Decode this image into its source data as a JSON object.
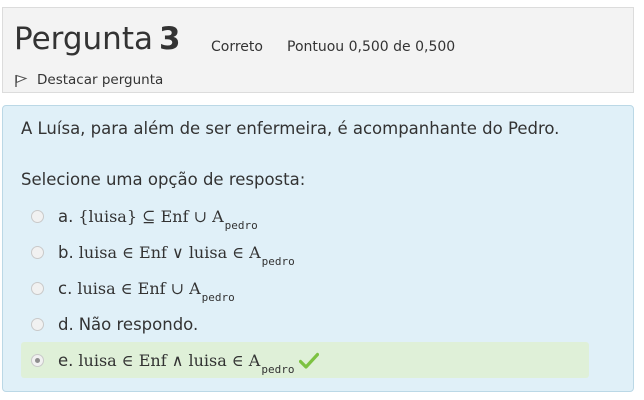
{
  "question": {
    "title_word": "Pergunta",
    "number": "3",
    "state": "Correto",
    "grade": "Pontuou 0,500 de 0,500",
    "flag_label": "Destacar pergunta"
  },
  "content": {
    "question_text": "A Luísa, para além de ser enfermeira, é acompanhante do Pedro.",
    "prompt": "Selecione uma opção de resposta:",
    "options": [
      {
        "letter": "a.",
        "math": "{luisa} ⊆ Enf ∪ A",
        "sub": "pedro"
      },
      {
        "letter": "b.",
        "math": "luisa ∈ Enf ∨ luisa ∈ A",
        "sub": "pedro"
      },
      {
        "letter": "c.",
        "math": "luisa ∈ Enf ∪ A",
        "sub": "pedro"
      },
      {
        "letter": "d.",
        "text": "Não respondo."
      },
      {
        "letter": "e.",
        "math": "luisa ∈ Enf ∧ luisa ∈ A",
        "sub": "pedro",
        "selected": true,
        "correct": true
      }
    ]
  },
  "colors": {
    "content_bg": "#e0f0f8",
    "correct_bg": "#dff0d8",
    "check_green": "#7dc242"
  }
}
